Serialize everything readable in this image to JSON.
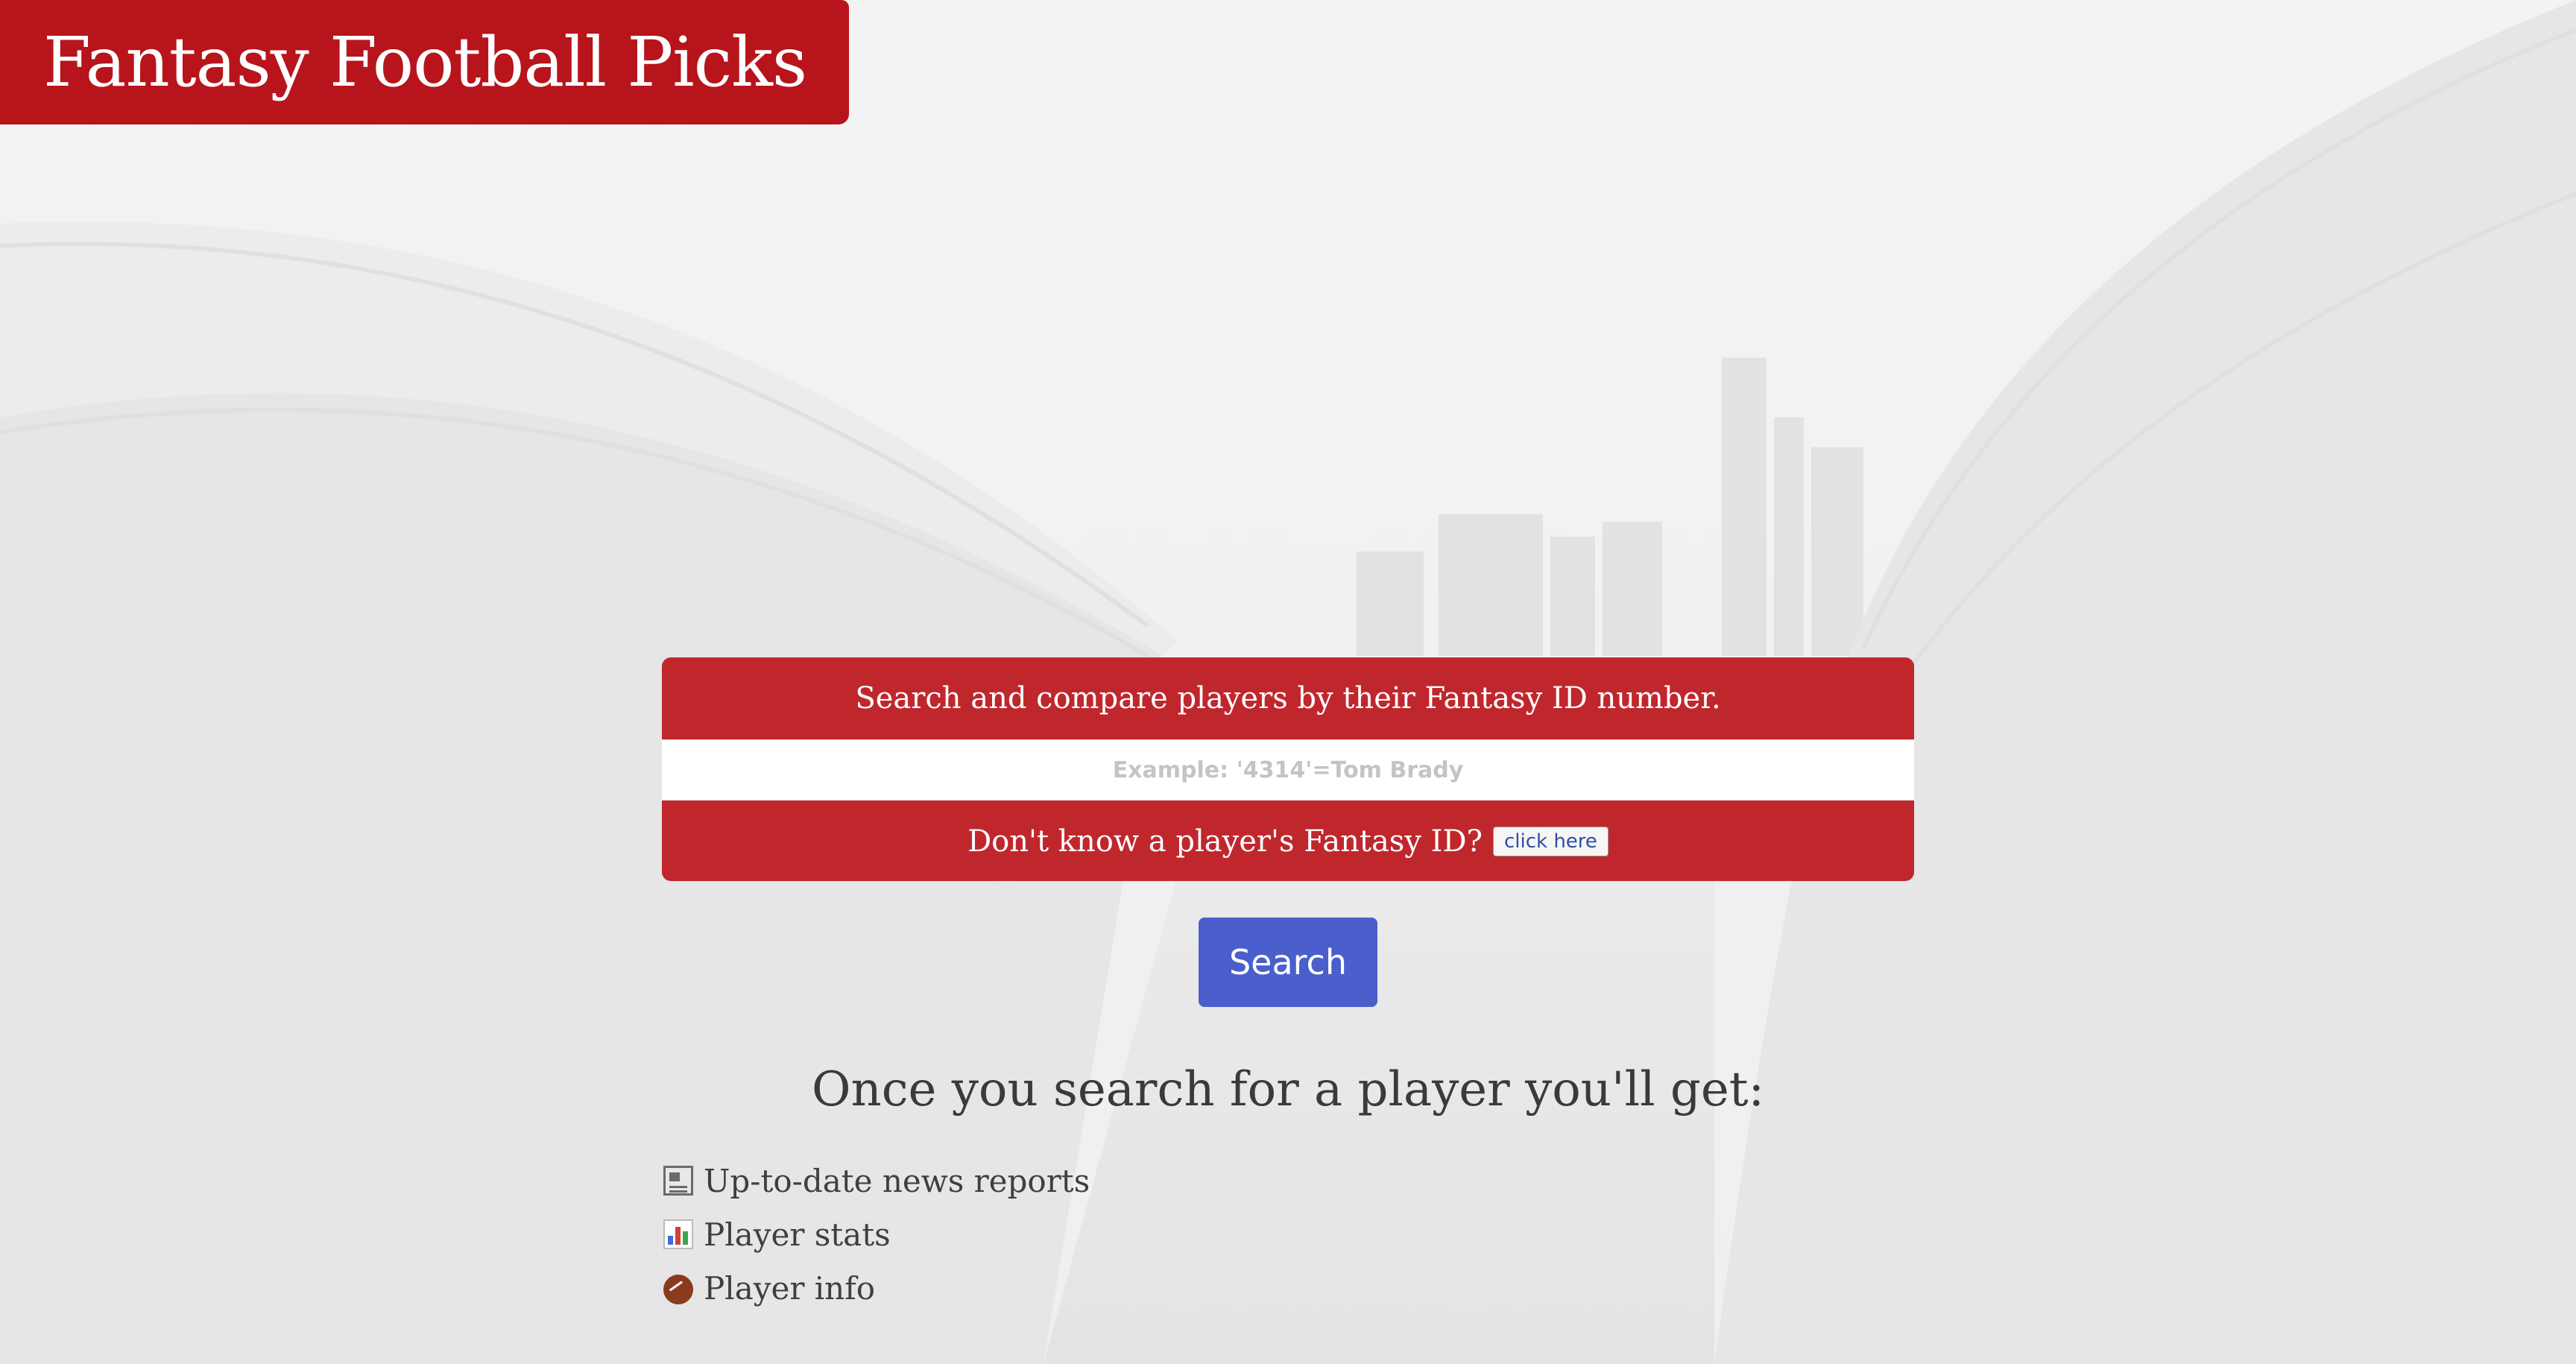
{
  "header": {
    "title": "Fantasy Football Picks"
  },
  "search_card": {
    "heading": "Search and compare players by their Fantasy ID number.",
    "input_placeholder": "Example: '4314'=Tom Brady",
    "input_value": "",
    "help_text": "Don't know a player's Fantasy ID?",
    "help_button_label": "click here"
  },
  "search_button": {
    "label": "Search"
  },
  "features": {
    "title": "Once you search for a player you'll get:",
    "items": [
      {
        "icon": "newspaper-icon",
        "label": "Up-to-date news reports"
      },
      {
        "icon": "bar-chart-icon",
        "label": "Player stats"
      },
      {
        "icon": "football-icon",
        "label": "Player info"
      }
    ]
  },
  "colors": {
    "brand_red": "#b8141c",
    "card_red": "#c0272d",
    "button_blue": "#4a5fcc",
    "background": "#f1f1f1"
  }
}
